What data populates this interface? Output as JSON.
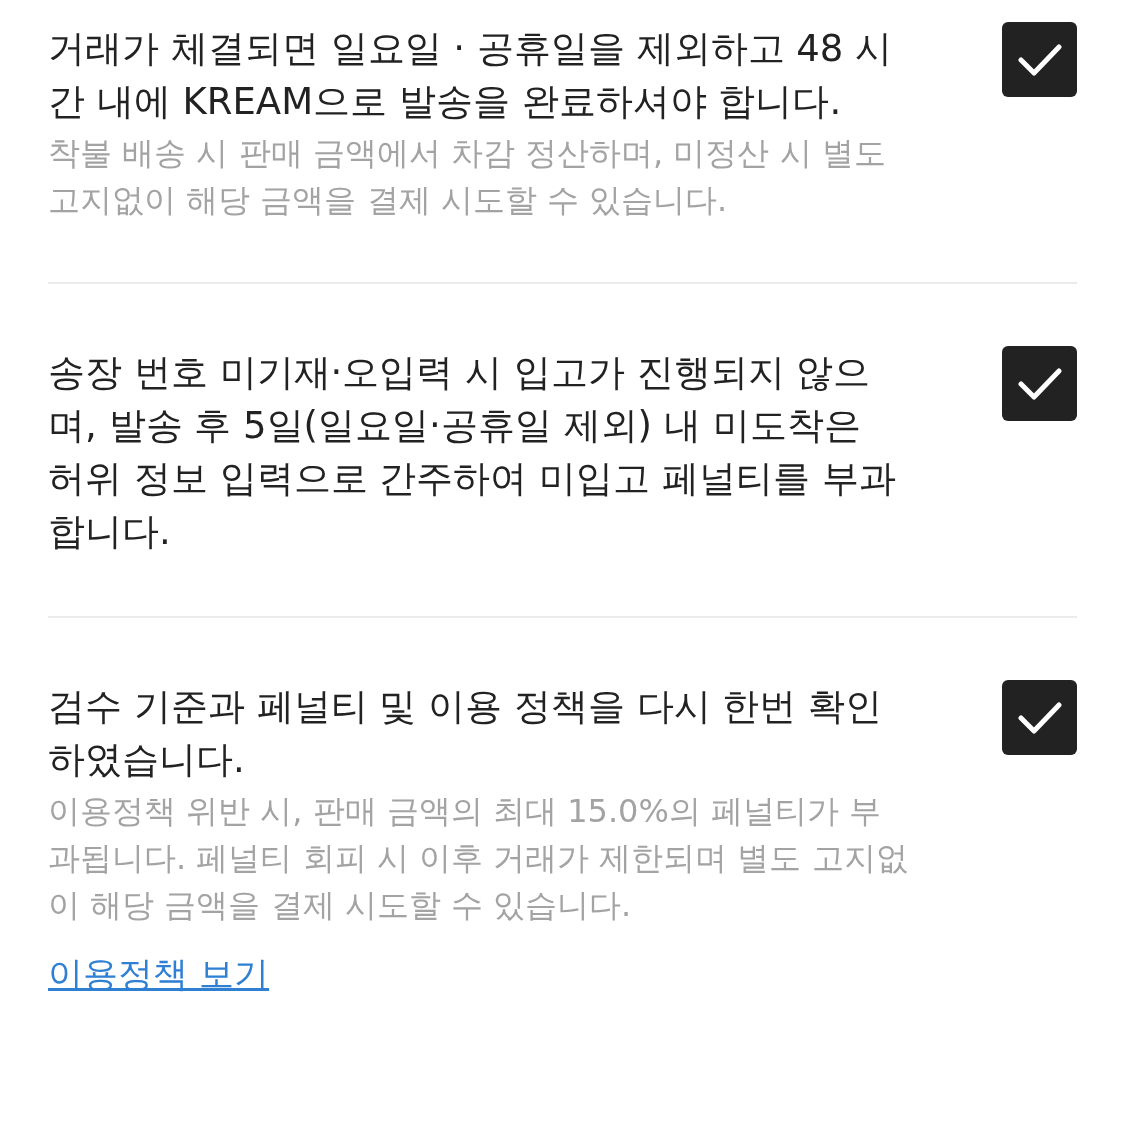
{
  "items": [
    {
      "title": "거래가 체결되면 일요일 · 공휴일을 제외하고 48 시간 내에 KREAM으로 발송을 완료하셔야 합니다.",
      "note": "착불 배송 시 판매 금액에서 차감 정산하며, 미정산 시 별도 고지없이 해당 금액을 결제 시도할 수 있습니다.",
      "checked": true
    },
    {
      "title": "송장 번호 미기재·오입력 시 입고가 진행되지 않으며, 발송 후 5일(일요일·공휴일 제외) 내 미도착은 허위 정보 입력으로 간주하여 미입고 페널티를 부과합니다.",
      "checked": true
    },
    {
      "title": "검수 기준과 페널티 및 이용 정책을 다시 한번 확인하였습니다.",
      "note": "이용정책 위반 시, 판매 금액의 최대 15.0%의 페널티가 부과됩니다. 페널티 회피 시 이후 거래가 제한되며 별도 고지없이 해당 금액을 결제 시도할 수 있습니다.",
      "link": "이용정책 보기",
      "checked": true
    }
  ]
}
